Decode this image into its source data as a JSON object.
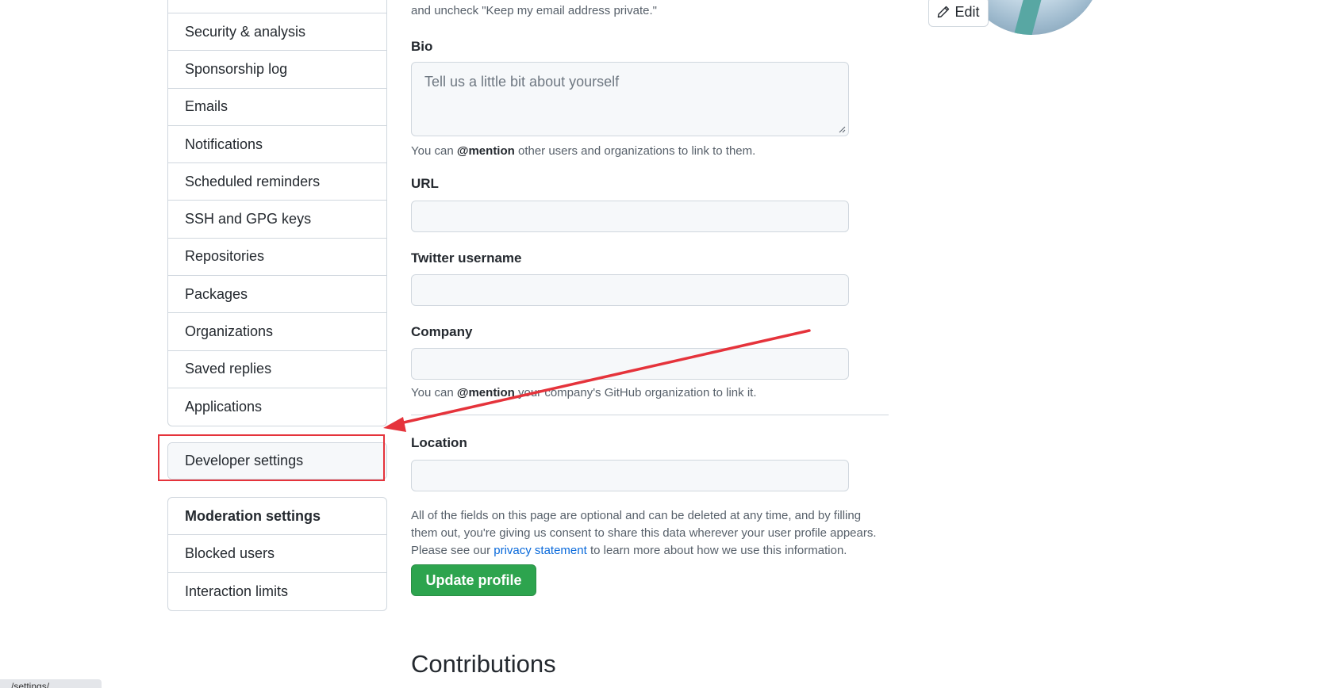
{
  "sidebar": {
    "main_items": [
      {
        "label": "Security & analysis"
      },
      {
        "label": "Sponsorship log"
      },
      {
        "label": "Emails"
      },
      {
        "label": "Notifications"
      },
      {
        "label": "Scheduled reminders"
      },
      {
        "label": "SSH and GPG keys"
      },
      {
        "label": "Repositories"
      },
      {
        "label": "Packages"
      },
      {
        "label": "Organizations"
      },
      {
        "label": "Saved replies"
      },
      {
        "label": "Applications"
      }
    ],
    "developer_settings": "Developer settings",
    "moderation": {
      "header": "Moderation settings",
      "items": [
        {
          "label": "Blocked users"
        },
        {
          "label": "Interaction limits"
        }
      ]
    }
  },
  "form": {
    "top_note": "and uncheck \"Keep my email address private.\"",
    "bio_label": "Bio",
    "bio_placeholder": "Tell us a little bit about yourself",
    "bio_note_prefix": "You can ",
    "bio_note_mention": "@mention",
    "bio_note_suffix": " other users and organizations to link to them.",
    "url_label": "URL",
    "twitter_label": "Twitter username",
    "company_label": "Company",
    "company_note_prefix": "You can ",
    "company_note_mention": "@mention",
    "company_note_suffix": " your company's GitHub organization to link it.",
    "location_label": "Location",
    "consent_line1": "All of the fields on this page are optional and can be deleted at any time, and by filling",
    "consent_line2": "them out, you're giving us consent to share this data wherever your user profile appears.",
    "consent_line3_prefix": "Please see our ",
    "consent_link": "privacy statement",
    "consent_line3_suffix": " to learn more about how we use this information.",
    "update_button": "Update profile"
  },
  "avatar": {
    "edit_label": "Edit"
  },
  "contributions": {
    "title": "Contributions"
  },
  "status_bar": {
    "url_fragment": "/settings/..."
  },
  "colors": {
    "accent_green": "#2da44e",
    "link_blue": "#0969da",
    "annotation_red": "#e5333b"
  }
}
